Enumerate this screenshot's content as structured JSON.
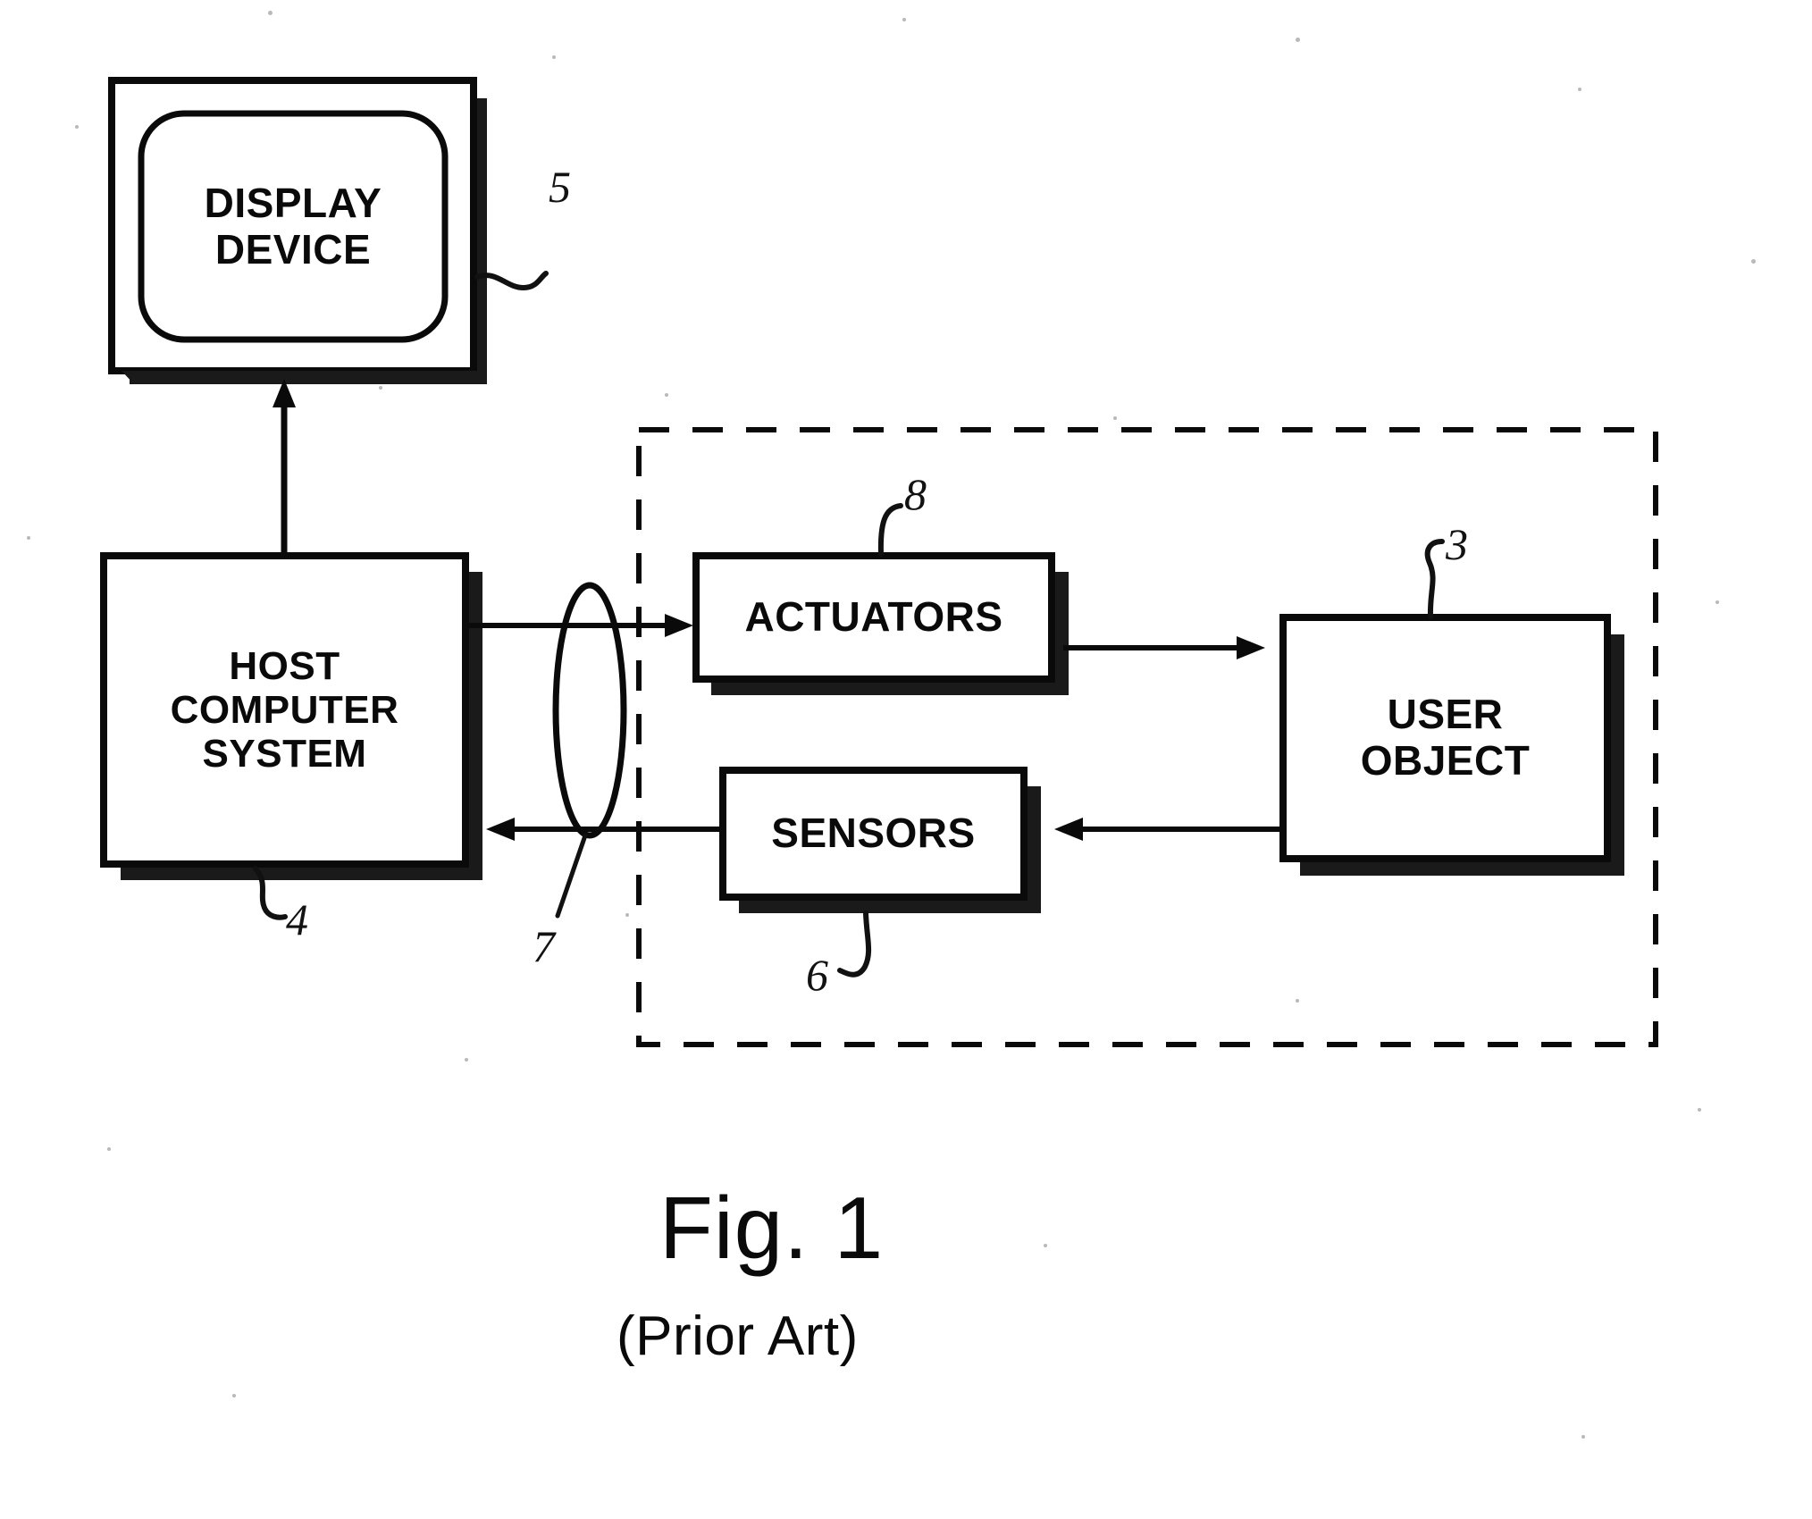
{
  "figure": {
    "caption_main": "Fig. 1",
    "caption_sub": "(Prior Art)",
    "background_color": "#ffffff",
    "ink_color": "#0a0a0a"
  },
  "blocks": [
    {
      "id": "display-device",
      "label_lines": [
        "DISPLAY",
        "DEVICE"
      ],
      "ref": "5",
      "shape": "crt-monitor"
    },
    {
      "id": "host-computer-system",
      "label_lines": [
        "HOST",
        "COMPUTER",
        "SYSTEM"
      ],
      "ref": "4",
      "shape": "rect-shadow"
    },
    {
      "id": "actuators",
      "label_lines": [
        "ACTUATORS"
      ],
      "ref": "8",
      "shape": "rect-shadow"
    },
    {
      "id": "sensors",
      "label_lines": [
        "SENSORS"
      ],
      "ref": "6",
      "shape": "rect-shadow"
    },
    {
      "id": "user-object",
      "label_lines": [
        "USER",
        "OBJECT"
      ],
      "ref": "3",
      "shape": "rect-shadow"
    }
  ],
  "interface": {
    "id": "interface-ellipse",
    "ref": "7",
    "shape": "ellipse"
  },
  "grouping": {
    "id": "interface-device-group",
    "style": "dashed-rectangle",
    "ref": ""
  },
  "connections": [
    {
      "from": "host-computer-system",
      "to": "display-device",
      "direction": "up"
    },
    {
      "from": "host-computer-system",
      "to": "actuators",
      "direction": "right"
    },
    {
      "from": "actuators",
      "to": "user-object",
      "direction": "right"
    },
    {
      "from": "user-object",
      "to": "sensors",
      "direction": "left"
    },
    {
      "from": "sensors",
      "to": "host-computer-system",
      "direction": "left"
    }
  ]
}
